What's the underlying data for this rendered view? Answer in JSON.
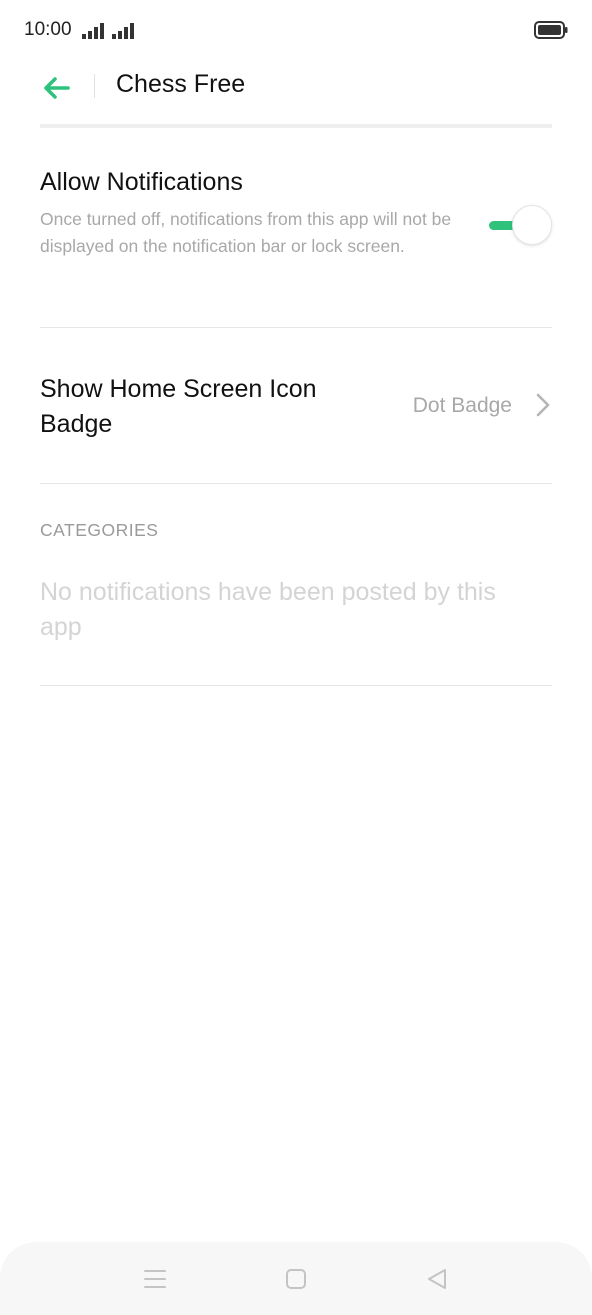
{
  "status_bar": {
    "time": "10:00",
    "icons": [
      "signal-icon",
      "signal-icon",
      "battery-icon"
    ]
  },
  "header": {
    "back_icon": "arrow-left-icon",
    "title": "Chess Free"
  },
  "allow_notifications": {
    "title": "Allow Notifications",
    "description": "Once turned off, notifications from this app will not be displayed on the notification bar or lock screen.",
    "enabled": true
  },
  "badge": {
    "title": "Show Home Screen Icon Badge",
    "value": "Dot Badge",
    "icon": "chevron-right-icon"
  },
  "categories": {
    "label": "CATEGORIES",
    "empty_text": "No notifications have been posted by this app"
  },
  "nav_bar": {
    "icons": [
      "menu-icon",
      "home-square-icon",
      "back-triangle-icon"
    ]
  },
  "colors": {
    "accent": "#2fc27c",
    "secondary_text": "#a8a8a8",
    "disabled_text": "#d4d4d4",
    "divider": "#e6e6e6"
  }
}
